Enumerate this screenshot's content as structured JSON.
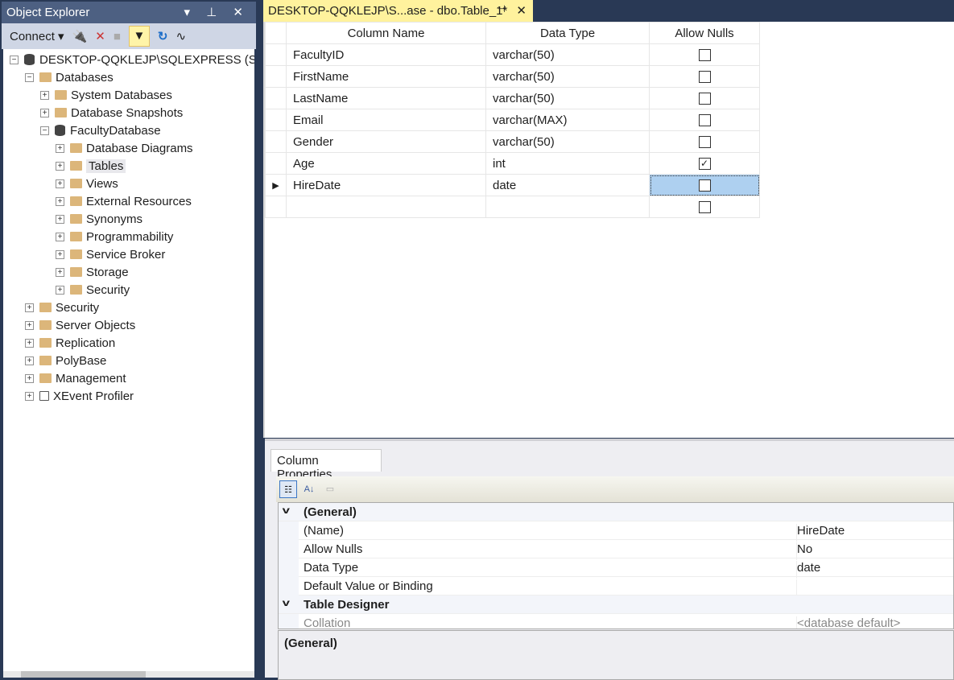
{
  "object_explorer": {
    "title": "Object Explorer",
    "title_controls": "▾ ⊥ ✕",
    "toolbar": {
      "connect_label": "Connect ▾"
    },
    "tree": [
      {
        "label": "DESKTOP-QQKLEJP\\SQLEXPRESS (SQL Server)",
        "level": 0,
        "expander": "−",
        "icon": "server-icon"
      },
      {
        "label": "Databases",
        "level": 1,
        "expander": "−",
        "icon": "folder-icon"
      },
      {
        "label": "System Databases",
        "level": 2,
        "expander": "+",
        "icon": "folder-icon"
      },
      {
        "label": "Database Snapshots",
        "level": 2,
        "expander": "+",
        "icon": "folder-icon"
      },
      {
        "label": "FacultyDatabase",
        "level": 2,
        "expander": "−",
        "icon": "database-icon"
      },
      {
        "label": "Database Diagrams",
        "level": 3,
        "expander": "+",
        "icon": "folder-icon"
      },
      {
        "label": "Tables",
        "level": 3,
        "expander": "+",
        "icon": "folder-icon",
        "selected": true
      },
      {
        "label": "Views",
        "level": 3,
        "expander": "+",
        "icon": "folder-icon"
      },
      {
        "label": "External Resources",
        "level": 3,
        "expander": "+",
        "icon": "folder-icon"
      },
      {
        "label": "Synonyms",
        "level": 3,
        "expander": "+",
        "icon": "folder-icon"
      },
      {
        "label": "Programmability",
        "level": 3,
        "expander": "+",
        "icon": "folder-icon"
      },
      {
        "label": "Service Broker",
        "level": 3,
        "expander": "+",
        "icon": "folder-icon"
      },
      {
        "label": "Storage",
        "level": 3,
        "expander": "+",
        "icon": "folder-icon"
      },
      {
        "label": "Security",
        "level": 3,
        "expander": "+",
        "icon": "folder-icon"
      },
      {
        "label": "Security",
        "level": 1,
        "expander": "+",
        "icon": "folder-icon"
      },
      {
        "label": "Server Objects",
        "level": 1,
        "expander": "+",
        "icon": "folder-icon"
      },
      {
        "label": "Replication",
        "level": 1,
        "expander": "+",
        "icon": "folder-icon"
      },
      {
        "label": "PolyBase",
        "level": 1,
        "expander": "+",
        "icon": "folder-icon"
      },
      {
        "label": "Management",
        "level": 1,
        "expander": "+",
        "icon": "folder-icon"
      },
      {
        "label": "XEvent Profiler",
        "level": 1,
        "expander": "+",
        "icon": "xevent-icon"
      }
    ]
  },
  "document_tab": {
    "title": "DESKTOP-QQKLEJP\\S...ase - dbo.Table_1*"
  },
  "designer": {
    "headers": [
      "Column Name",
      "Data Type",
      "Allow Nulls"
    ],
    "rows": [
      {
        "name": "FacultyID",
        "type": "varchar(50)",
        "nulls": false
      },
      {
        "name": "FirstName",
        "type": "varchar(50)",
        "nulls": false
      },
      {
        "name": "LastName",
        "type": "varchar(50)",
        "nulls": false
      },
      {
        "name": "Email",
        "type": "varchar(MAX)",
        "nulls": false
      },
      {
        "name": "Gender",
        "type": "varchar(50)",
        "nulls": false
      },
      {
        "name": "Age",
        "type": "int",
        "nulls": true
      },
      {
        "name": "HireDate",
        "type": "date",
        "nulls": false,
        "current": true
      },
      {
        "name": "",
        "type": "",
        "nulls": false
      }
    ]
  },
  "column_properties": {
    "tab": "Column Properties",
    "rows": [
      {
        "category": true,
        "key": "(General)"
      },
      {
        "key": "(Name)",
        "value": "HireDate"
      },
      {
        "key": "Allow Nulls",
        "value": "No"
      },
      {
        "key": "Data Type",
        "value": "date"
      },
      {
        "key": "Default Value or Binding",
        "value": ""
      },
      {
        "category": true,
        "key": "Table Designer"
      },
      {
        "key": "Collation",
        "value": "<database default>",
        "disabled": true
      }
    ],
    "description": "(General)"
  }
}
